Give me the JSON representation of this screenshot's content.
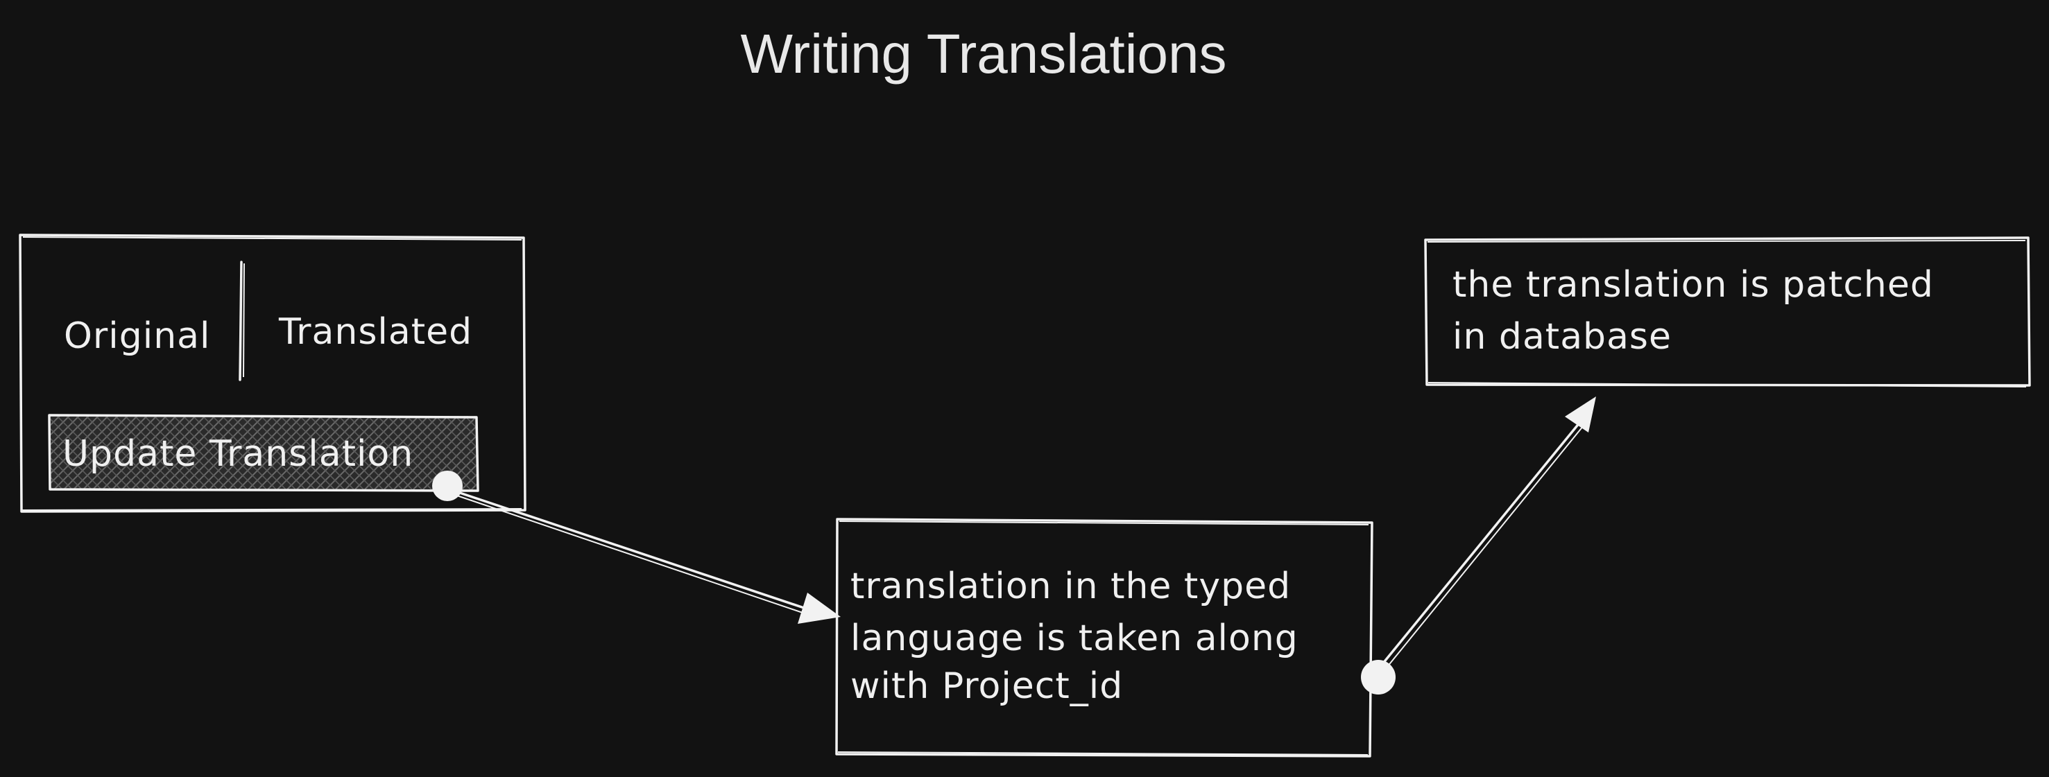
{
  "title": "Writing Translations",
  "ui_card": {
    "original_label": "Original",
    "translated_label": "Translated",
    "button_label": "Update Translation"
  },
  "nodes": {
    "middle": {
      "line1": "translation in the typed",
      "line2": "language is taken along",
      "line3": "with Project_id"
    },
    "right": {
      "line1": "the translation is patched",
      "line2": "in database"
    }
  },
  "colors": {
    "background": "#121212",
    "stroke": "#f2f2f2",
    "text": "#f0f0f0"
  }
}
